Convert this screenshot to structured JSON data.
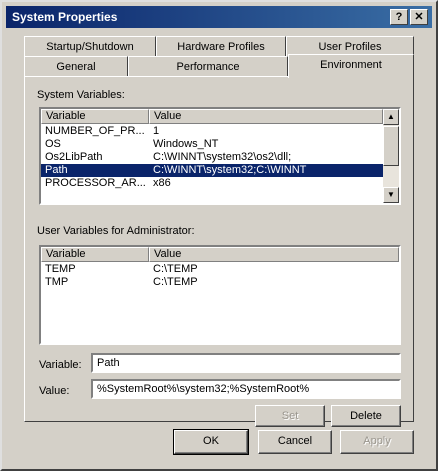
{
  "window": {
    "title": "System Properties",
    "help_label": "?",
    "close_label": "✕"
  },
  "tabs": {
    "row1": [
      "Startup/Shutdown",
      "Hardware Profiles",
      "User Profiles"
    ],
    "row2": [
      "General",
      "Performance",
      "Environment"
    ],
    "active": "Environment"
  },
  "system_vars": {
    "heading": "System Variables:",
    "col_variable": "Variable",
    "col_value": "Value",
    "rows": [
      {
        "variable": "NUMBER_OF_PR...",
        "value": "1"
      },
      {
        "variable": "OS",
        "value": "Windows_NT"
      },
      {
        "variable": "Os2LibPath",
        "value": "C:\\WINNT\\system32\\os2\\dll;"
      },
      {
        "variable": "Path",
        "value": "C:\\WINNT\\system32;C:\\WINNT"
      },
      {
        "variable": "PROCESSOR_AR...",
        "value": "x86"
      }
    ],
    "selected_index": 3
  },
  "user_vars": {
    "heading": "User Variables for Administrator:",
    "col_variable": "Variable",
    "col_value": "Value",
    "rows": [
      {
        "variable": "TEMP",
        "value": "C:\\TEMP"
      },
      {
        "variable": "TMP",
        "value": "C:\\TEMP"
      }
    ]
  },
  "editor": {
    "variable_label": "Variable:",
    "variable_value": "Path",
    "value_label": "Value:",
    "value_value": "%SystemRoot%\\system32;%SystemRoot%"
  },
  "buttons": {
    "set": "Set",
    "delete": "Delete",
    "ok": "OK",
    "cancel": "Cancel",
    "apply": "Apply"
  },
  "icons": {
    "scroll_up": "scroll-up-arrow-icon",
    "scroll_down": "scroll-down-arrow-icon"
  }
}
